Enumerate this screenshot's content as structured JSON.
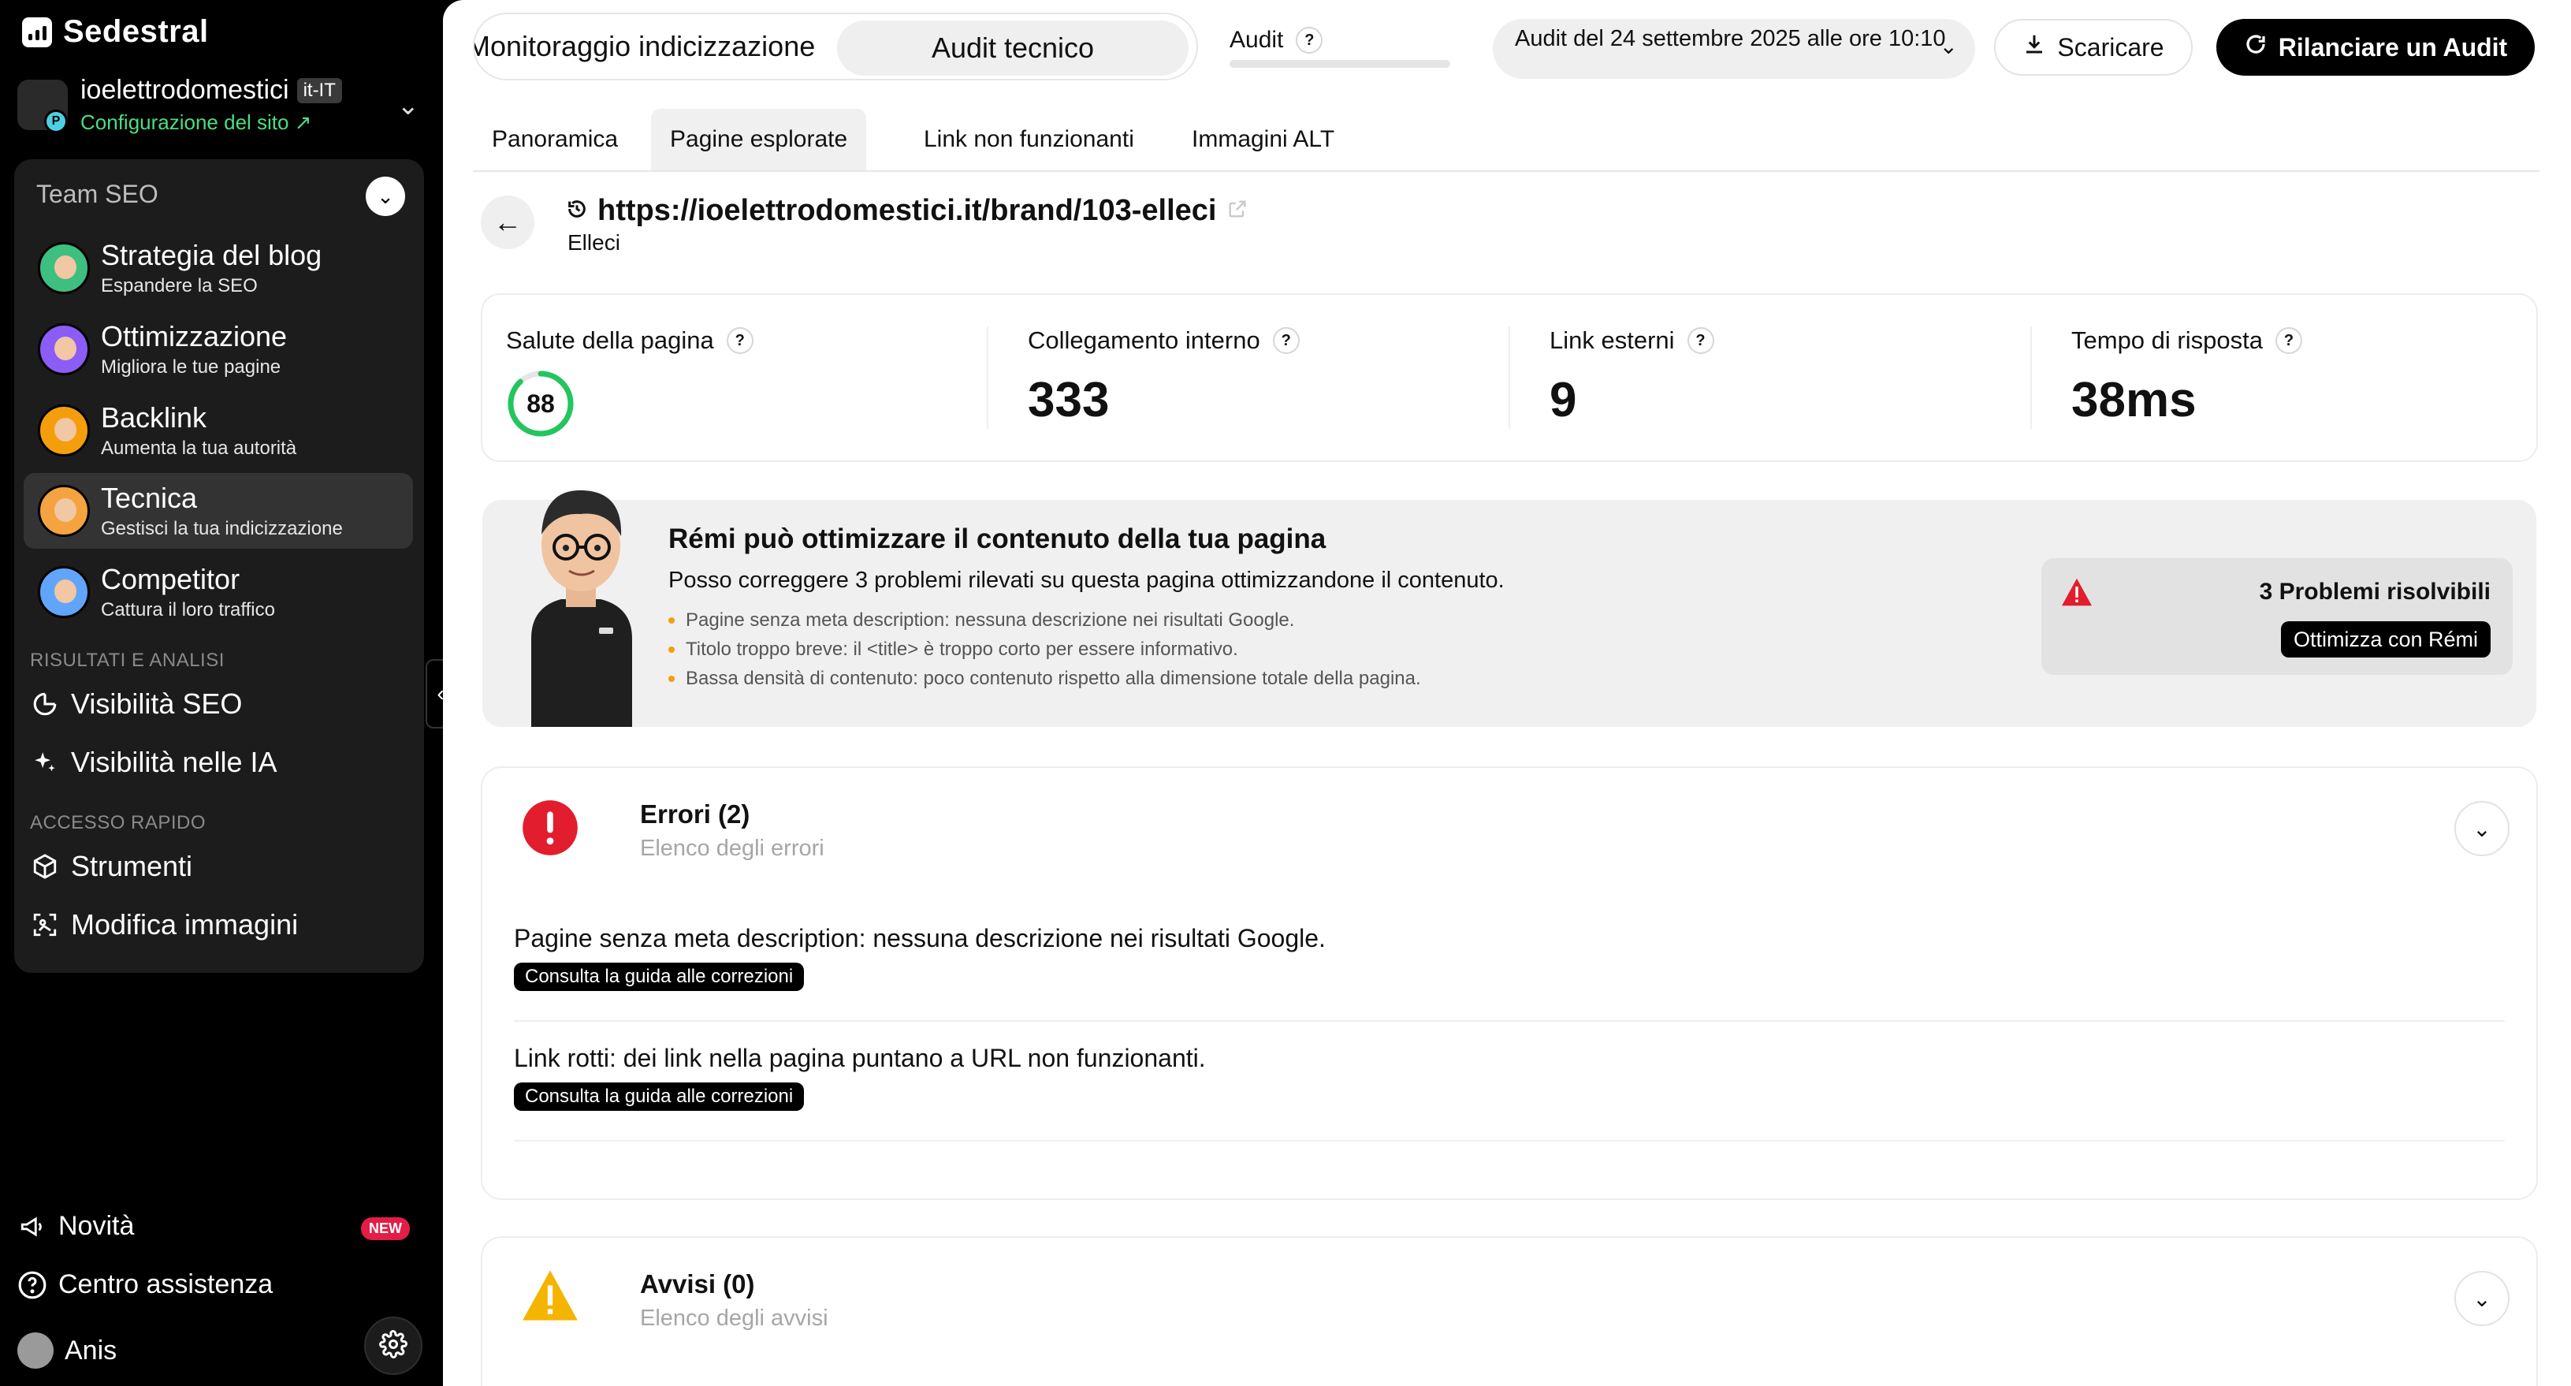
{
  "app": {
    "brand": "Sedestral"
  },
  "site": {
    "name": "ioelettrodomestici",
    "lang": "it-IT",
    "config": "Configurazione del sito ↗",
    "badge": "P"
  },
  "team": {
    "title": "Team SEO",
    "agents": [
      {
        "name": "Strategia del blog",
        "desc": "Espandere la SEO",
        "color": "#3fbf7f"
      },
      {
        "name": "Ottimizzazione",
        "desc": "Migliora le tue pagine",
        "color": "#8b5cf6"
      },
      {
        "name": "Backlink",
        "desc": "Aumenta la tua autorità",
        "color": "#f59e0b"
      },
      {
        "name": "Tecnica",
        "desc": "Gestisci la tua indicizzazione",
        "color": "#f4a340"
      },
      {
        "name": "Competitor",
        "desc": "Cattura il loro traffico",
        "color": "#60a5fa"
      }
    ]
  },
  "sections": {
    "results": "RISULTATI E ANALISI",
    "seo_visibility": "Visibilità SEO",
    "ai_visibility": "Visibilità nelle IA",
    "quick_access": "ACCESSO RAPIDO",
    "tools": "Strumenti",
    "edit_images": "Modifica immagini"
  },
  "bottom": {
    "news": "Novità",
    "news_badge": "NEW",
    "help": "Centro assistenza",
    "user": "Anis"
  },
  "topbar": {
    "seg_a": "Monitoraggio indicizzazione",
    "seg_b": "Audit tecnico",
    "audit_label": "Audit",
    "date": "Audit del 24 settembre 2025 alle ore 10:10",
    "download": "Scaricare",
    "rerun": "Rilanciare un Audit"
  },
  "tabs": [
    "Panoramica",
    "Pagine esplorate",
    "Link non funzionanti",
    "Immagini ALT"
  ],
  "page": {
    "url": "https://ioelettrodomestici.it/brand/103-elleci",
    "title": "Elleci"
  },
  "metrics": {
    "health_label": "Salute della pagina",
    "health_value": "88",
    "health_fraction": 0.88,
    "internal_label": "Collegamento interno",
    "internal_value": "333",
    "external_label": "Link esterni",
    "external_value": "9",
    "response_label": "Tempo di risposta",
    "response_value": "38ms"
  },
  "remi": {
    "title": "Rémi può ottimizzare il contenuto della tua pagina",
    "subtitle": "Posso correggere 3 problemi rilevati su questa pagina ottimizzandone il contenuto.",
    "items": [
      "Pagine senza meta description: nessuna descrizione nei risultati Google.",
      "Titolo troppo breve: il <title> è troppo corto per essere informativo.",
      "Bassa densità di contenuto: poco contenuto rispetto alla dimensione totale della pagina."
    ],
    "fix_count": "3 Problemi risolvibili",
    "fix_button": "Ottimizza con Rémi"
  },
  "errors": {
    "title": "Errori (2)",
    "subtitle": "Elenco degli errori",
    "items": [
      {
        "text": "Pagine senza meta description: nessuna descrizione nei risultati Google.",
        "button": "Consulta la guida alle correzioni"
      },
      {
        "text": "Link rotti: dei link nella pagina puntano a URL non funzionanti.",
        "button": "Consulta la guida alle correzioni"
      }
    ]
  },
  "warnings": {
    "title": "Avvisi (0)",
    "subtitle": "Elenco degli avvisi"
  },
  "colors": {
    "accent_green": "#4ade80",
    "error_red": "#e11d2e",
    "warning_yellow": "#f5b400",
    "gauge_green": "#22c55e"
  }
}
